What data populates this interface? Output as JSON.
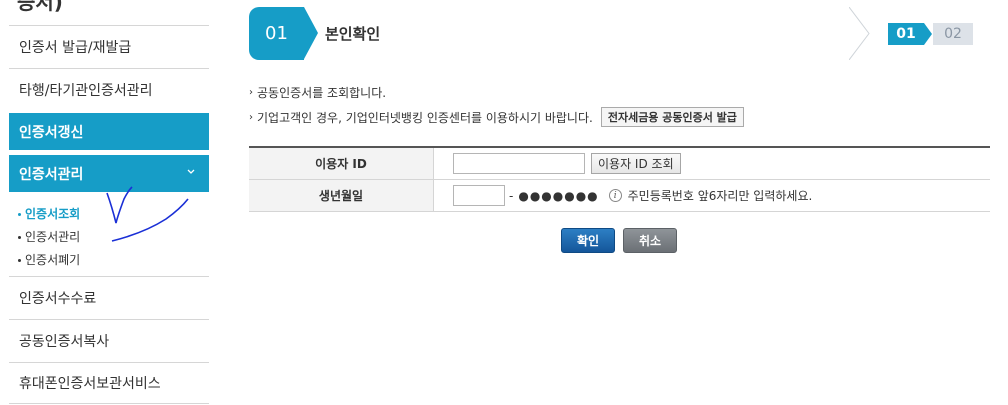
{
  "sidebar": {
    "title_fragment": "증서)",
    "items": [
      {
        "label": "인증서 발급/재발급"
      },
      {
        "label": "타행/타기관인증서관리"
      },
      {
        "label": "인증서갱신"
      },
      {
        "label": "인증서관리"
      },
      {
        "label": "인증서수수료"
      },
      {
        "label": "공동인증서복사"
      },
      {
        "label": "휴대폰인증서보관서비스"
      }
    ],
    "sub_items": [
      {
        "label": "인증서조회"
      },
      {
        "label": "인증서관리"
      },
      {
        "label": "인증서폐기"
      }
    ]
  },
  "step": {
    "number": "01",
    "title": "본인확인",
    "badge_current": "01",
    "badge_next": "02"
  },
  "info": {
    "line1": "공동인증서를 조회합니다.",
    "line2": "기업고객인 경우, 기업인터넷뱅킹 인증센터를 이용하시기 바랍니다.",
    "line2_button": "전자세금용 공동인증서 발급"
  },
  "form": {
    "user_id_label": "이용자 ID",
    "user_id_value": "",
    "user_id_lookup": "이용자 ID 조회",
    "birth_label": "생년월일",
    "birth_value": "",
    "birth_dash": "-",
    "birth_mask": "●●●●●●●",
    "birth_hint": "주민등록번호 앞6자리만 입력하세요."
  },
  "actions": {
    "confirm": "확인",
    "cancel": "취소"
  },
  "colors": {
    "accent": "#169dc7",
    "confirm": "#1e67ad",
    "cancel": "#7d8287",
    "scribble": "#1a2fd6"
  }
}
